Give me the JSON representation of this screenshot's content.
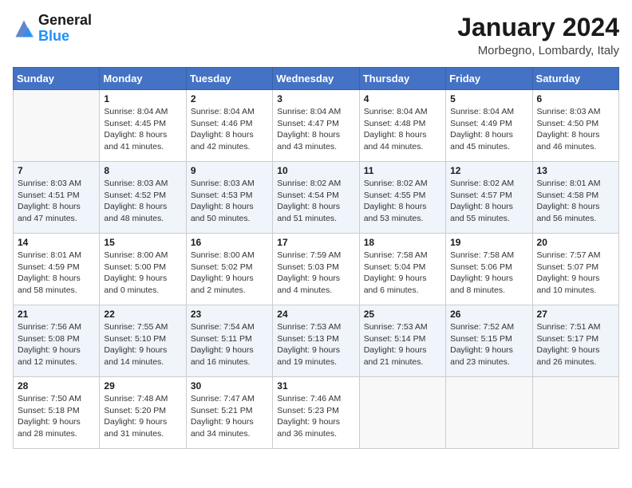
{
  "logo": {
    "line1": "General",
    "line2": "Blue"
  },
  "header": {
    "month": "January 2024",
    "location": "Morbegno, Lombardy, Italy"
  },
  "weekdays": [
    "Sunday",
    "Monday",
    "Tuesday",
    "Wednesday",
    "Thursday",
    "Friday",
    "Saturday"
  ],
  "weeks": [
    [
      {
        "day": "",
        "info": ""
      },
      {
        "day": "1",
        "info": "Sunrise: 8:04 AM\nSunset: 4:45 PM\nDaylight: 8 hours\nand 41 minutes."
      },
      {
        "day": "2",
        "info": "Sunrise: 8:04 AM\nSunset: 4:46 PM\nDaylight: 8 hours\nand 42 minutes."
      },
      {
        "day": "3",
        "info": "Sunrise: 8:04 AM\nSunset: 4:47 PM\nDaylight: 8 hours\nand 43 minutes."
      },
      {
        "day": "4",
        "info": "Sunrise: 8:04 AM\nSunset: 4:48 PM\nDaylight: 8 hours\nand 44 minutes."
      },
      {
        "day": "5",
        "info": "Sunrise: 8:04 AM\nSunset: 4:49 PM\nDaylight: 8 hours\nand 45 minutes."
      },
      {
        "day": "6",
        "info": "Sunrise: 8:03 AM\nSunset: 4:50 PM\nDaylight: 8 hours\nand 46 minutes."
      }
    ],
    [
      {
        "day": "7",
        "info": "Sunrise: 8:03 AM\nSunset: 4:51 PM\nDaylight: 8 hours\nand 47 minutes."
      },
      {
        "day": "8",
        "info": "Sunrise: 8:03 AM\nSunset: 4:52 PM\nDaylight: 8 hours\nand 48 minutes."
      },
      {
        "day": "9",
        "info": "Sunrise: 8:03 AM\nSunset: 4:53 PM\nDaylight: 8 hours\nand 50 minutes."
      },
      {
        "day": "10",
        "info": "Sunrise: 8:02 AM\nSunset: 4:54 PM\nDaylight: 8 hours\nand 51 minutes."
      },
      {
        "day": "11",
        "info": "Sunrise: 8:02 AM\nSunset: 4:55 PM\nDaylight: 8 hours\nand 53 minutes."
      },
      {
        "day": "12",
        "info": "Sunrise: 8:02 AM\nSunset: 4:57 PM\nDaylight: 8 hours\nand 55 minutes."
      },
      {
        "day": "13",
        "info": "Sunrise: 8:01 AM\nSunset: 4:58 PM\nDaylight: 8 hours\nand 56 minutes."
      }
    ],
    [
      {
        "day": "14",
        "info": "Sunrise: 8:01 AM\nSunset: 4:59 PM\nDaylight: 8 hours\nand 58 minutes."
      },
      {
        "day": "15",
        "info": "Sunrise: 8:00 AM\nSunset: 5:00 PM\nDaylight: 9 hours\nand 0 minutes."
      },
      {
        "day": "16",
        "info": "Sunrise: 8:00 AM\nSunset: 5:02 PM\nDaylight: 9 hours\nand 2 minutes."
      },
      {
        "day": "17",
        "info": "Sunrise: 7:59 AM\nSunset: 5:03 PM\nDaylight: 9 hours\nand 4 minutes."
      },
      {
        "day": "18",
        "info": "Sunrise: 7:58 AM\nSunset: 5:04 PM\nDaylight: 9 hours\nand 6 minutes."
      },
      {
        "day": "19",
        "info": "Sunrise: 7:58 AM\nSunset: 5:06 PM\nDaylight: 9 hours\nand 8 minutes."
      },
      {
        "day": "20",
        "info": "Sunrise: 7:57 AM\nSunset: 5:07 PM\nDaylight: 9 hours\nand 10 minutes."
      }
    ],
    [
      {
        "day": "21",
        "info": "Sunrise: 7:56 AM\nSunset: 5:08 PM\nDaylight: 9 hours\nand 12 minutes."
      },
      {
        "day": "22",
        "info": "Sunrise: 7:55 AM\nSunset: 5:10 PM\nDaylight: 9 hours\nand 14 minutes."
      },
      {
        "day": "23",
        "info": "Sunrise: 7:54 AM\nSunset: 5:11 PM\nDaylight: 9 hours\nand 16 minutes."
      },
      {
        "day": "24",
        "info": "Sunrise: 7:53 AM\nSunset: 5:13 PM\nDaylight: 9 hours\nand 19 minutes."
      },
      {
        "day": "25",
        "info": "Sunrise: 7:53 AM\nSunset: 5:14 PM\nDaylight: 9 hours\nand 21 minutes."
      },
      {
        "day": "26",
        "info": "Sunrise: 7:52 AM\nSunset: 5:15 PM\nDaylight: 9 hours\nand 23 minutes."
      },
      {
        "day": "27",
        "info": "Sunrise: 7:51 AM\nSunset: 5:17 PM\nDaylight: 9 hours\nand 26 minutes."
      }
    ],
    [
      {
        "day": "28",
        "info": "Sunrise: 7:50 AM\nSunset: 5:18 PM\nDaylight: 9 hours\nand 28 minutes."
      },
      {
        "day": "29",
        "info": "Sunrise: 7:48 AM\nSunset: 5:20 PM\nDaylight: 9 hours\nand 31 minutes."
      },
      {
        "day": "30",
        "info": "Sunrise: 7:47 AM\nSunset: 5:21 PM\nDaylight: 9 hours\nand 34 minutes."
      },
      {
        "day": "31",
        "info": "Sunrise: 7:46 AM\nSunset: 5:23 PM\nDaylight: 9 hours\nand 36 minutes."
      },
      {
        "day": "",
        "info": ""
      },
      {
        "day": "",
        "info": ""
      },
      {
        "day": "",
        "info": ""
      }
    ]
  ]
}
